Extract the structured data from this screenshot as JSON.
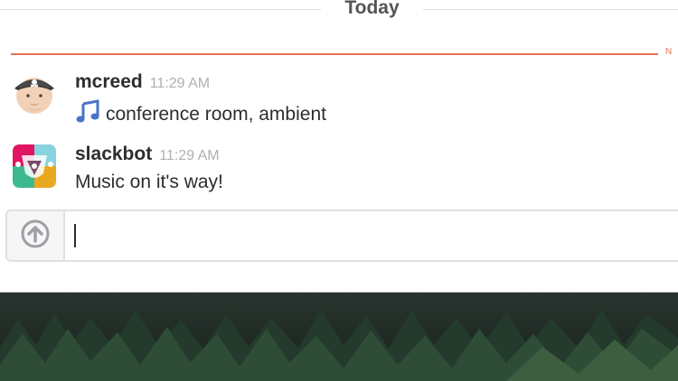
{
  "divider": {
    "day_label": "Today",
    "new_label": "N"
  },
  "messages": [
    {
      "username": "mcreed",
      "time": "11:29 AM",
      "text": "conference room, ambient",
      "emoji": "musical-note-icon",
      "avatar": "pirate-avatar"
    },
    {
      "username": "slackbot",
      "time": "11:29 AM",
      "text": "Music on it's way!",
      "avatar": "slackbot-avatar"
    }
  ],
  "composer": {
    "value": "",
    "placeholder": ""
  },
  "colors": {
    "new_divider": "#e8734e",
    "username": "#2c2d30",
    "timestamp": "#b0b0b4",
    "forest": "#1f2a24"
  }
}
